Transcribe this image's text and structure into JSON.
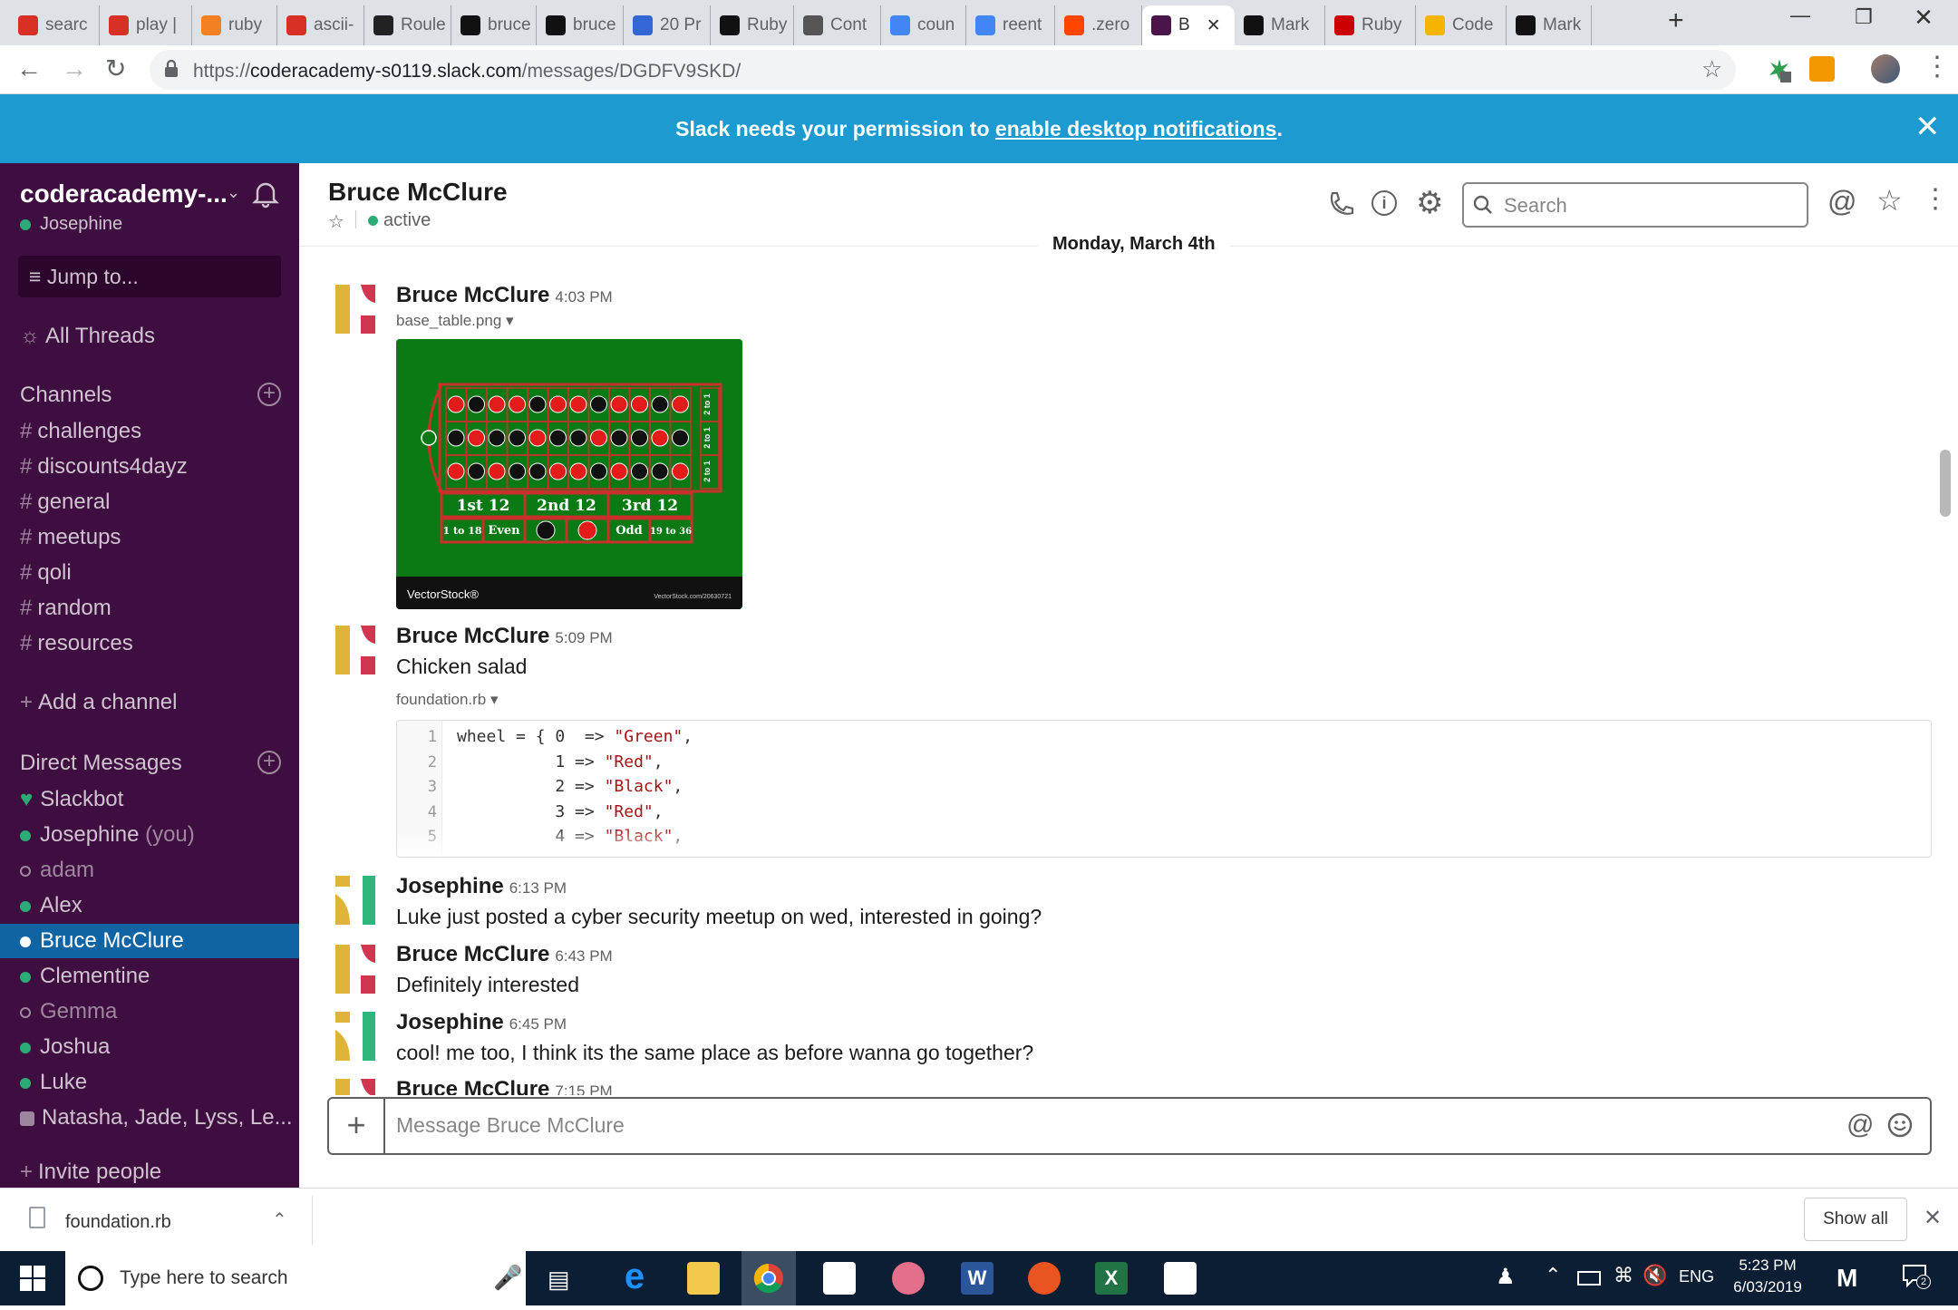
{
  "browser": {
    "tabs": [
      {
        "label": "searc",
        "fav_color": "#d93025"
      },
      {
        "label": "play |",
        "fav_color": "#d93025"
      },
      {
        "label": "ruby",
        "fav_color": "#f48024"
      },
      {
        "label": "ascii-",
        "fav_color": "#d93025"
      },
      {
        "label": "Roule",
        "fav_color": "#222"
      },
      {
        "label": "bruce",
        "fav_color": "#111"
      },
      {
        "label": "bruce",
        "fav_color": "#111"
      },
      {
        "label": "20 Pr",
        "fav_color": "#3367d6"
      },
      {
        "label": "Ruby",
        "fav_color": "#111"
      },
      {
        "label": "Cont",
        "fav_color": "#555"
      },
      {
        "label": "coun",
        "fav_color": "#4285f4"
      },
      {
        "label": "reent",
        "fav_color": "#4285f4"
      },
      {
        "label": ".zero",
        "fav_color": "#ff4500"
      },
      {
        "label": "B",
        "fav_color": "#4a154b"
      },
      {
        "label": "Mark",
        "fav_color": "#111"
      },
      {
        "label": "Ruby",
        "fav_color": "#cc0000"
      },
      {
        "label": "Code",
        "fav_color": "#f4b400"
      },
      {
        "label": "Mark",
        "fav_color": "#111"
      }
    ],
    "url_prefix": "https://",
    "url_host": "coderacademy-s0119.slack.com",
    "url_path": "/messages/DGDFV9SKD/"
  },
  "banner": {
    "text": "Slack needs your permission to ",
    "link": "enable desktop notifications",
    "suffix": "."
  },
  "sidebar": {
    "workspace": "coderacademy-...",
    "user": "Josephine",
    "jump": "Jump to...",
    "all_threads": "All Threads",
    "channels_label": "Channels",
    "channels": [
      "challenges",
      "discounts4dayz",
      "general",
      "meetups",
      "qoli",
      "random",
      "resources"
    ],
    "add_channel": "Add a channel",
    "dm_label": "Direct Messages",
    "dms": [
      {
        "name": "Slackbot",
        "status": "bot"
      },
      {
        "name": "Josephine",
        "suffix": "(you)",
        "status": "active"
      },
      {
        "name": "adam",
        "status": "away"
      },
      {
        "name": "Alex",
        "status": "active"
      },
      {
        "name": "Bruce McClure",
        "status": "active",
        "selected": true
      },
      {
        "name": "Clementine",
        "status": "active"
      },
      {
        "name": "Gemma",
        "status": "away"
      },
      {
        "name": "Joshua",
        "status": "active"
      },
      {
        "name": "Luke",
        "status": "active"
      },
      {
        "name": "Natasha, Jade, Lyss, Le...",
        "status": "group"
      }
    ],
    "invite": "Invite people"
  },
  "header": {
    "title": "Bruce McClure",
    "status": "active",
    "search_placeholder": "Search"
  },
  "date_divider": "Monday, March 4th",
  "messages": [
    {
      "author": "Bruce McClure",
      "time": "4:03 PM",
      "file": "base_table.png"
    },
    {
      "author": "Bruce McClure",
      "time": "5:09 PM",
      "text": "Chicken salad",
      "file": "foundation.rb"
    },
    {
      "author": "Josephine",
      "time": "6:13 PM",
      "text": "Luke just posted a cyber security meetup on wed, interested in going?"
    },
    {
      "author": "Bruce McClure",
      "time": "6:43 PM",
      "text": "Definitely interested"
    },
    {
      "author": "Josephine",
      "time": "6:45 PM",
      "text": "cool! me too, I think its the same place as before wanna go together?"
    },
    {
      "author": "Bruce McClure",
      "time": "7:15 PM"
    }
  ],
  "image_preview": {
    "dozens": [
      "1st 12",
      "2nd 12",
      "3rd 12"
    ],
    "outside": [
      "1 to 18",
      "Even",
      "Odd",
      "19 to 36"
    ],
    "column_label": "2 to 1",
    "brand": "VectorStock®",
    "watermark": "VectorStock.com/20630721"
  },
  "code": {
    "lines": [
      {
        "n": "1",
        "pre": "wheel = { 0  => ",
        "str": "\"Green\"",
        "post": ","
      },
      {
        "n": "2",
        "pre": "          1 => ",
        "str": "\"Red\"",
        "post": ","
      },
      {
        "n": "3",
        "pre": "          2 => ",
        "str": "\"Black\"",
        "post": ","
      },
      {
        "n": "4",
        "pre": "          3 => ",
        "str": "\"Red\"",
        "post": ","
      },
      {
        "n": "5",
        "pre": "          4 => ",
        "str": "\"Black\"",
        "post": ","
      }
    ]
  },
  "composer": {
    "placeholder": "Message Bruce McClure"
  },
  "downloads": {
    "file": "foundation.rb",
    "show_all": "Show all"
  },
  "taskbar": {
    "search_placeholder": "Type here to search",
    "lang": "ENG",
    "time": "5:23 PM",
    "date": "6/03/2019",
    "notification_count": "2"
  }
}
